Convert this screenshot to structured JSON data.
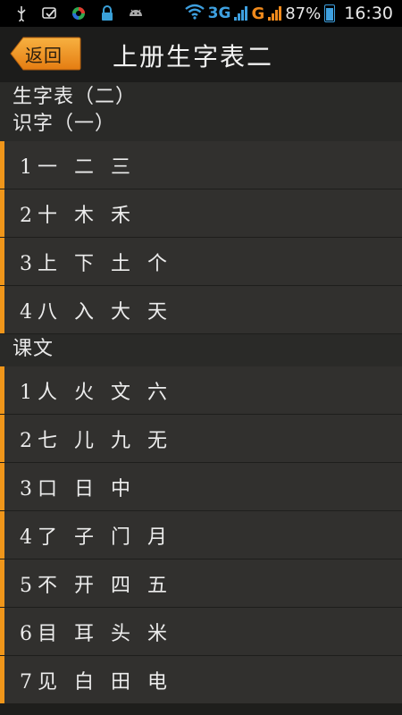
{
  "status_bar": {
    "icons": [
      "usb-icon",
      "voicemail-icon",
      "app-circle-icon",
      "lock-icon",
      "android-icon"
    ],
    "network_1": "3G",
    "network_2": "G",
    "battery": "87%",
    "time": "16:30"
  },
  "header": {
    "back_label": "返回",
    "title": "上册生字表二"
  },
  "sections": [
    {
      "title": "生字表（二）",
      "subtitle": "识字（一）",
      "items": [
        {
          "label": "1一 二 三"
        },
        {
          "label": "2十 木 禾"
        },
        {
          "label": "3上 下 土 个"
        },
        {
          "label": "4八 入 大 天"
        }
      ]
    },
    {
      "title": "课文",
      "items": [
        {
          "label": "1人 火 文 六"
        },
        {
          "label": "2七 儿 九 无"
        },
        {
          "label": "3口 日 中"
        },
        {
          "label": "4了 子 门 月"
        },
        {
          "label": "5不 开 四 五"
        },
        {
          "label": "6目 耳 头 米"
        },
        {
          "label": "7见 白 田 电"
        }
      ]
    }
  ],
  "colors": {
    "accent": "#f0961a",
    "row_bg": "#31302e",
    "section_bg": "#2a2a28",
    "page_bg": "#1e1e1c"
  }
}
